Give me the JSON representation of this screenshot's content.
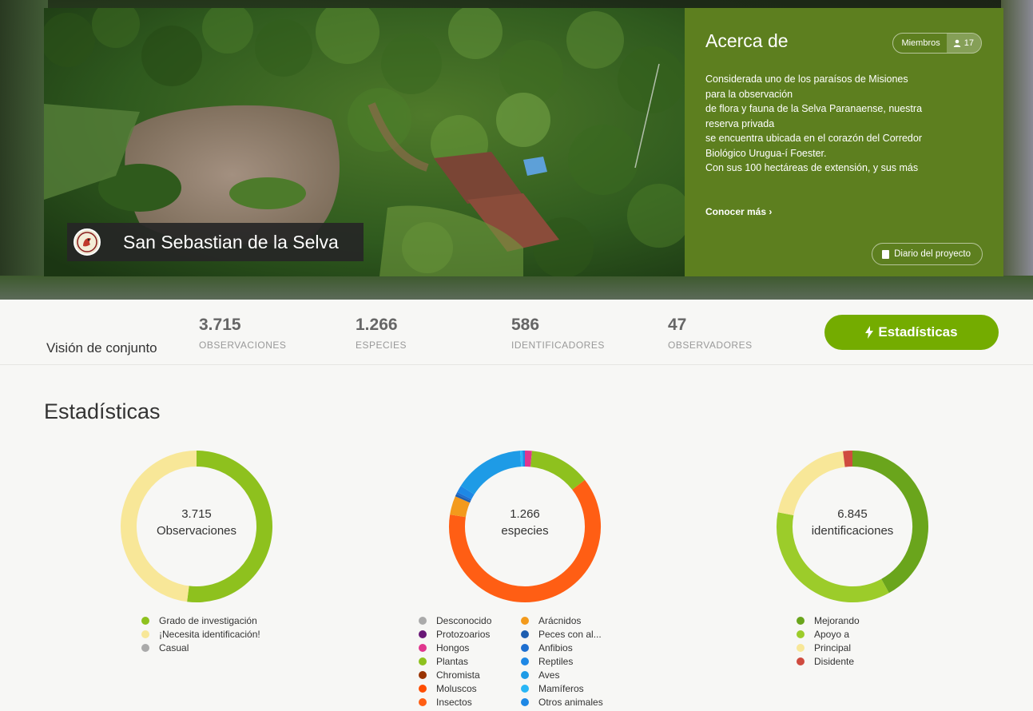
{
  "hero": {
    "project_title": "San Sebastian de la Selva",
    "about": {
      "title": "Acerca de",
      "members_label": "Miembros",
      "members_count": "17",
      "text_lines": [
        "Considerada uno de los paraísos de Misiones",
        "para la observación",
        "de flora y fauna de la Selva Paranaense, nuestra",
        "reserva privada",
        "se encuentra ubicada en el corazón del Corredor",
        "Biológico Urugua-í Foester.",
        "Con sus 100 hectáreas de extensión, y sus más"
      ],
      "learn_more": "Conocer más ›",
      "journal_button": "Diario del proyecto"
    }
  },
  "overview": {
    "label": "Visión de conjunto",
    "stats": [
      {
        "number": "3.715",
        "label": "OBSERVACIONES"
      },
      {
        "number": "1.266",
        "label": "ESPECIES"
      },
      {
        "number": "586",
        "label": "IDENTIFICADORES"
      },
      {
        "number": "47",
        "label": "OBSERVADORES"
      }
    ],
    "button": "Estadísticas"
  },
  "section_title": "Estadísticas",
  "chart_data": [
    {
      "type": "pie",
      "center_value": "3.715",
      "center_label": "Observaciones",
      "series": [
        {
          "name": "Grado de investigación",
          "value": 0.52,
          "color": "#8ec11e"
        },
        {
          "name": "¡Necesita identificación!",
          "value": 0.48,
          "color": "#f8e798"
        },
        {
          "name": "Casual",
          "value": 0.0,
          "color": "#aaaaaa"
        }
      ]
    },
    {
      "type": "pie",
      "center_value": "1.266",
      "center_label": "especies",
      "series": [
        {
          "name": "Desconocido",
          "value": 0.0,
          "color": "#aaaaaa"
        },
        {
          "name": "Protozoarios",
          "value": 0.0,
          "color": "#691776"
        },
        {
          "name": "Hongos",
          "value": 0.015,
          "color": "#e0368e"
        },
        {
          "name": "Plantas",
          "value": 0.13,
          "color": "#8ec11e"
        },
        {
          "name": "Chromista",
          "value": 0.0,
          "color": "#993300"
        },
        {
          "name": "Moluscos",
          "value": 0.0,
          "color": "#ff4d00"
        },
        {
          "name": "Insectos",
          "value": 0.63,
          "color": "#ff5e14"
        },
        {
          "name": "Arácnidos",
          "value": 0.04,
          "color": "#f39a1c"
        },
        {
          "name": "Peces con al...",
          "value": 0.005,
          "color": "#1e5eb0"
        },
        {
          "name": "Anfibios",
          "value": 0.005,
          "color": "#1e6fd0"
        },
        {
          "name": "Reptiles",
          "value": 0.015,
          "color": "#1e88e5"
        },
        {
          "name": "Aves",
          "value": 0.15,
          "color": "#1e9be6"
        },
        {
          "name": "Mamíferos",
          "value": 0.005,
          "color": "#29b6f6"
        },
        {
          "name": "Otros animales",
          "value": 0.005,
          "color": "#1e88e5"
        }
      ]
    },
    {
      "type": "pie",
      "center_value": "6.845",
      "center_label": "identificaciones",
      "series": [
        {
          "name": "Mejorando",
          "value": 0.42,
          "color": "#6aa51c"
        },
        {
          "name": "Apoyo a",
          "value": 0.36,
          "color": "#9ccc2a"
        },
        {
          "name": "Principal",
          "value": 0.2,
          "color": "#f8e798"
        },
        {
          "name": "Disidente",
          "value": 0.02,
          "color": "#cf4b3f"
        }
      ]
    }
  ]
}
